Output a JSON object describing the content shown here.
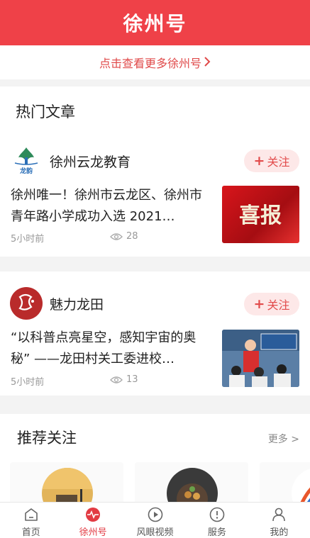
{
  "header": {
    "title": "徐州号"
  },
  "more_bar": {
    "label": "点击查看更多徐州号"
  },
  "hot": {
    "title": "热门文章",
    "articles": [
      {
        "author": "徐州云龙教育",
        "follow": "关注",
        "text": "徐州唯一！徐州市云龙区、徐州市青年路小学成功入选 2021…",
        "time": "5小时前",
        "views": "28",
        "thumb_text": "喜报",
        "avatar_text": "龙韵"
      },
      {
        "author": "魅力龙田",
        "follow": "关注",
        "text": "“以科普点亮星空，感知宇宙的奥秘” ——龙田村关工委进校…",
        "time": "5小时前",
        "views": "13"
      }
    ]
  },
  "recommend": {
    "title": "推荐关注",
    "more": "更多 >"
  },
  "tabs": [
    {
      "label": "首页",
      "icon": "home-icon",
      "active": false
    },
    {
      "label": "徐州号",
      "icon": "pulse-icon",
      "active": true
    },
    {
      "label": "风眼视频",
      "icon": "play-icon",
      "active": false
    },
    {
      "label": "服务",
      "icon": "info-icon",
      "active": false
    },
    {
      "label": "我的",
      "icon": "user-icon",
      "active": false
    }
  ],
  "colors": {
    "brand": "#ef4148",
    "follow_bg": "#fde8e8",
    "follow_text": "#e24b4b"
  }
}
